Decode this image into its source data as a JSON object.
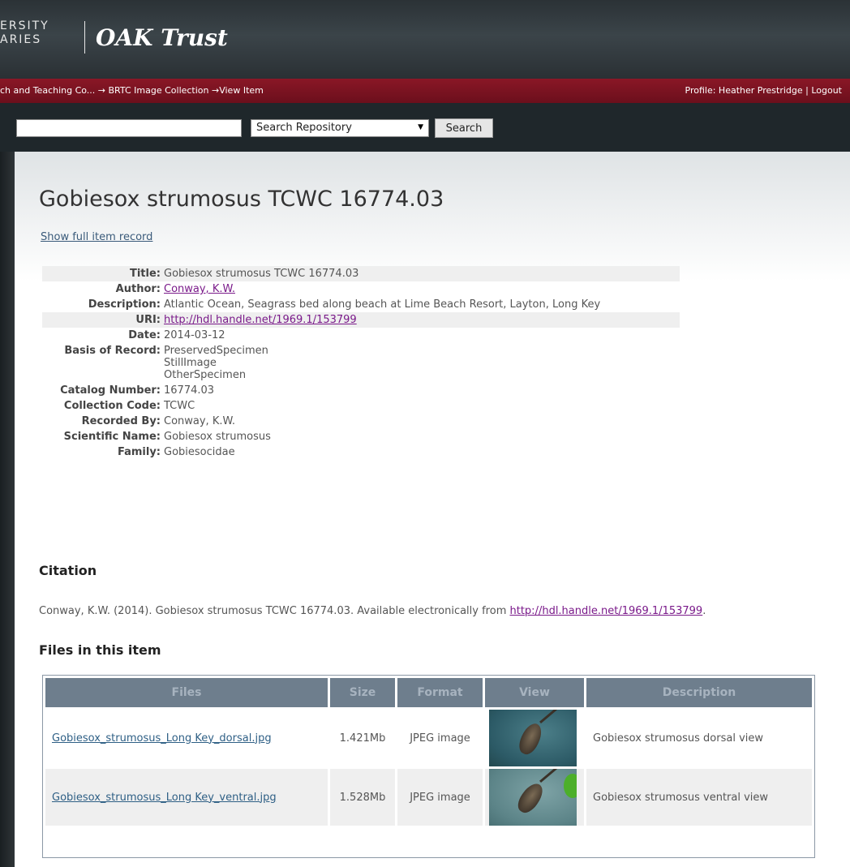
{
  "header": {
    "logo_line1": "ERSITY",
    "logo_line2": "ARIES",
    "logo_title": "OAK Trust"
  },
  "breadcrumb": {
    "text": "ch and Teaching Co... → BRTC Image Collection →View Item",
    "profile": "Profile: Heather Prestridge | Logout"
  },
  "search": {
    "input_value": "",
    "scope_selected": "Search Repository",
    "button_label": "Search"
  },
  "item": {
    "title": "Gobiesox strumosus TCWC 16774.03",
    "full_record_link": "Show full item record"
  },
  "metadata": [
    {
      "label": "Title:",
      "value": "Gobiesox strumosus TCWC 16774.03"
    },
    {
      "label": "Author:",
      "value": "Conway, K.W.",
      "link": true
    },
    {
      "label": "Description:",
      "value": "Atlantic Ocean, Seagrass bed along beach at Lime Beach Resort, Layton, Long Key"
    },
    {
      "label": "URI:",
      "value": "http://hdl.handle.net/1969.1/153799",
      "link": true
    },
    {
      "label": "Date:",
      "value": "2014-03-12"
    },
    {
      "label": "Basis of Record:",
      "value": "PreservedSpecimen",
      "value2": "StillImage",
      "value3": "OtherSpecimen"
    },
    {
      "label": "Catalog Number:",
      "value": "16774.03"
    },
    {
      "label": "Collection Code:",
      "value": "TCWC"
    },
    {
      "label": "Recorded By:",
      "value": "Conway, K.W."
    },
    {
      "label": "Scientific Name:",
      "value": "Gobiesox strumosus"
    },
    {
      "label": "Family:",
      "value": "Gobiesocidae"
    }
  ],
  "citation": {
    "heading": "Citation",
    "text": "Conway, K.W. (2014). Gobiesox strumosus TCWC 16774.03. Available electronically from",
    "link": "http://hdl.handle.net/1969.1/153799",
    "tail": "."
  },
  "files": {
    "heading": "Files in this item",
    "columns": [
      "Files",
      "Size",
      "Format",
      "View",
      "Description"
    ],
    "rows": [
      {
        "file": "Gobiesox_strumosus_Long Key_dorsal.jpg",
        "size": "1.421Mb",
        "format": "JPEG image",
        "description": "Gobiesox strumosus dorsal view"
      },
      {
        "file": "Gobiesox_strumosus_Long Key_ventral.jpg",
        "size": "1.528Mb",
        "format": "JPEG image",
        "description": "Gobiesox strumosus ventral view"
      }
    ]
  }
}
